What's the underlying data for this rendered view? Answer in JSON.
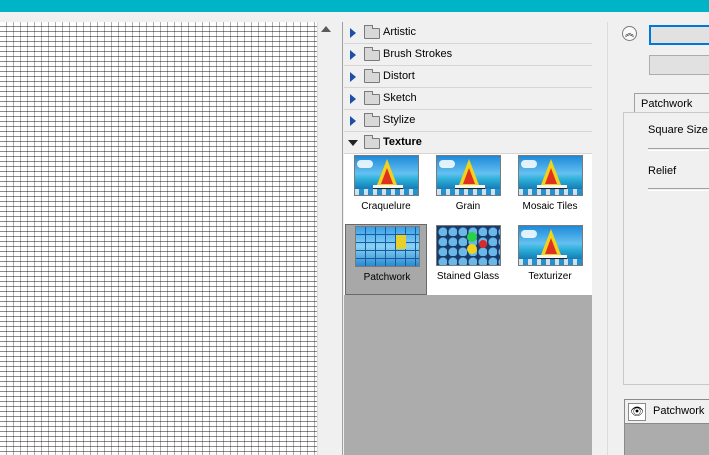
{
  "colors": {
    "top_bar": "#00b4c8",
    "list_bg": "#acacac",
    "selected_thumb": "#a8a8a8",
    "expand_arrow": "#1e4fa8"
  },
  "categories": [
    {
      "label": "Artistic",
      "expanded": false
    },
    {
      "label": "Brush Strokes",
      "expanded": false
    },
    {
      "label": "Distort",
      "expanded": false
    },
    {
      "label": "Sketch",
      "expanded": false
    },
    {
      "label": "Stylize",
      "expanded": false
    },
    {
      "label": "Texture",
      "expanded": true
    }
  ],
  "thumbnails": [
    {
      "label": "Craquelure",
      "selected": false
    },
    {
      "label": "Grain",
      "selected": false
    },
    {
      "label": "Mosaic Tiles",
      "selected": false
    },
    {
      "label": "Patchwork",
      "selected": true
    },
    {
      "label": "Stained Glass",
      "selected": false
    },
    {
      "label": "Texturizer",
      "selected": false
    }
  ],
  "settings": {
    "collapse_icon": "double-chevron-up-icon",
    "tab_label": "Patchwork",
    "square_size_label": "Square Size",
    "relief_label": "Relief"
  },
  "effect_layers": [
    {
      "label": "Patchwork",
      "visible": true,
      "icon": "eye-icon"
    }
  ]
}
